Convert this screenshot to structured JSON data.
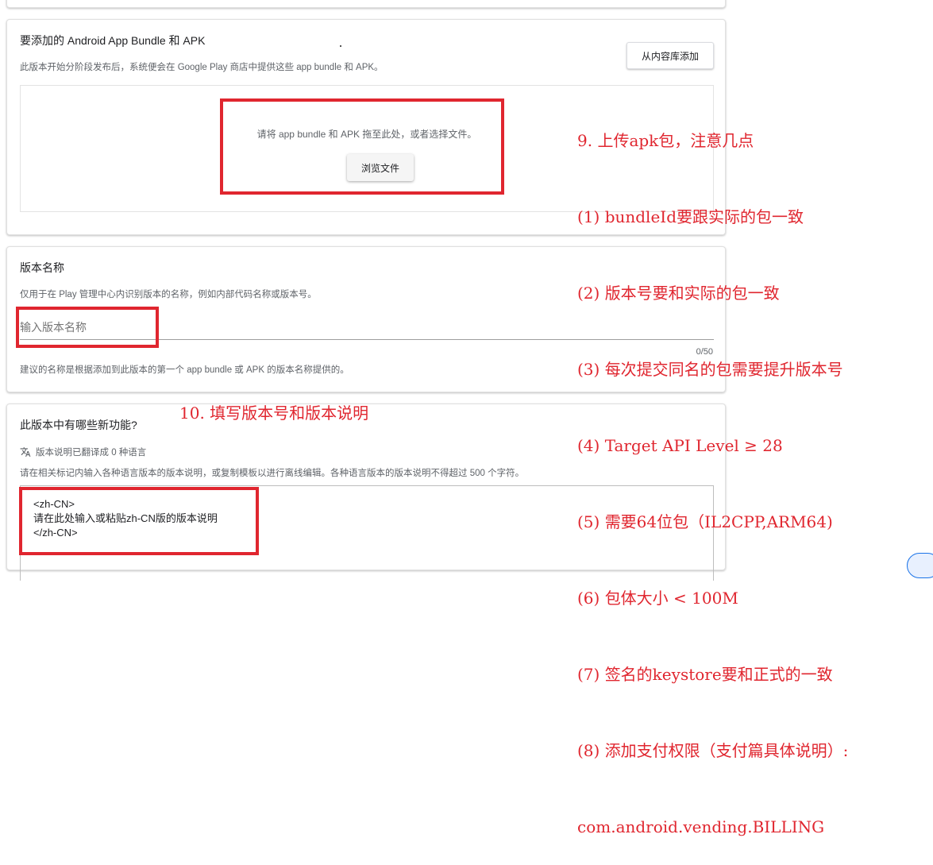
{
  "bundle_section": {
    "title": "要添加的 Android App Bundle 和 APK",
    "description": "此版本开始分阶段发布后，系统便会在 Google Play 商店中提供这些 app bundle 和 APK。",
    "library_button": "从内容库添加",
    "drop_text": "请将 app bundle 和 APK 拖至此处，或者选择文件。",
    "browse_button": "浏览文件"
  },
  "name_section": {
    "title": "版本名称",
    "description": "仅用于在 Play 管理中心内识别版本的名称，例如内部代码名称或版本号。",
    "placeholder": "输入版本名称",
    "counter": "0/50",
    "hint": "建议的名称是根据添加到此版本的第一个 app bundle 或 APK 的版本名称提供的。"
  },
  "notes_section": {
    "title": "此版本中有哪些新功能?",
    "translate_status": "版本说明已翻译成 0 种语言",
    "description": "请在相关标记内输入各种语言版本的版本说明，或复制模板以进行离线编辑。各种语言版本的版本说明不得超过 500 个字符。",
    "lines": [
      "<zh-CN>",
      "请在此处输入或粘贴zh-CN版的版本说明",
      "</zh-CN>"
    ]
  },
  "annotations": {
    "step9": [
      "9. 上传apk包，注意几点",
      "(1) bundleId要跟实际的包一致",
      "(2) 版本号要和实际的包一致",
      "(3) 每次提交同名的包需要提升版本号",
      "(4) Target API Level ≥ 28",
      "(5) 需要64位包（IL2CPP,ARM64)",
      "(6) 包体大小 < 100M",
      "(7) 签名的keystore要和正式的一致",
      "(8) 添加支付权限（支付篇具体说明）:",
      "com.android.vending.BILLING"
    ],
    "step10": "10. 填写版本号和版本说明"
  },
  "colors": {
    "annotation_red": "#e0262f",
    "muted_text": "#5f6368"
  },
  "icons": {
    "translate": "translate-icon"
  }
}
